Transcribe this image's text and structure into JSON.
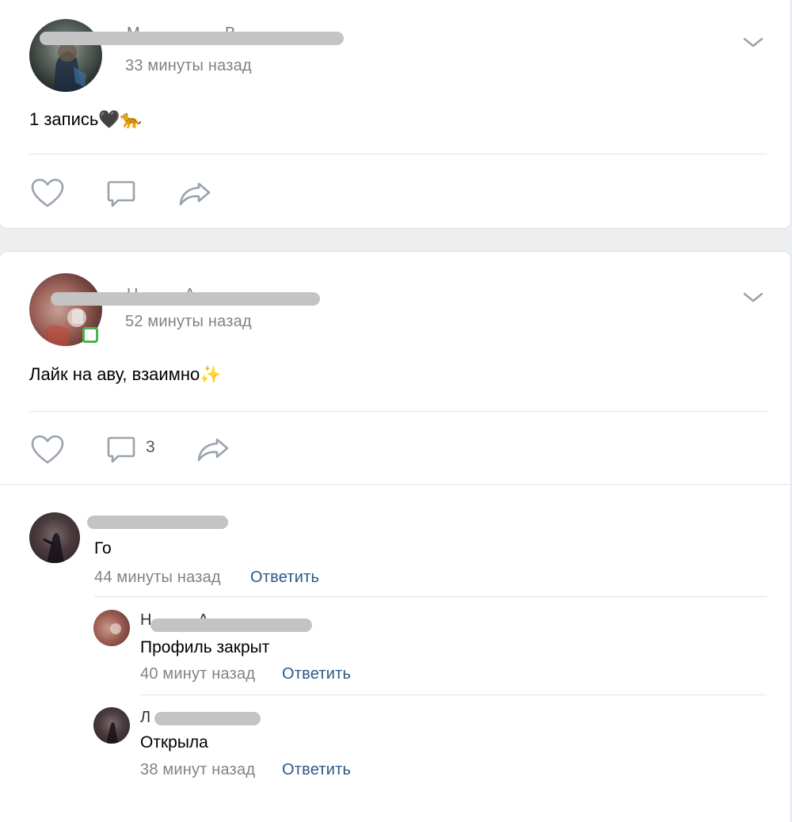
{
  "posts": [
    {
      "time": "33 минуты назад",
      "text": "1 запись🖤🐆",
      "name_fragment_start": "М",
      "name_fragment_end": "В"
    },
    {
      "time": "52 минуты назад",
      "text": "Лайк на аву, взаимно✨",
      "name_fragment_start": "Н",
      "name_fragment_end": "А",
      "comments_count": "3"
    }
  ],
  "comments": [
    {
      "text": "Го",
      "time": "44 минуты назад",
      "reply_label": "Ответить"
    },
    {
      "name_fragment": "Н",
      "name_fragment_end": "А",
      "text": "Профиль закрыт",
      "time": "40 минут назад",
      "reply_label": "Ответить"
    },
    {
      "name_fragment": "Л",
      "text": "Открыла",
      "time": "38 минут назад",
      "reply_label": "Ответить"
    }
  ],
  "icons": {
    "like": "heart-outline",
    "comment": "speech-bubble-outline",
    "share": "share-arrow",
    "menu": "chevron-down"
  },
  "colors": {
    "link": "#2a5885",
    "meta": "#828282",
    "icon": "#99a2ad",
    "page_bg": "#edeef0"
  }
}
